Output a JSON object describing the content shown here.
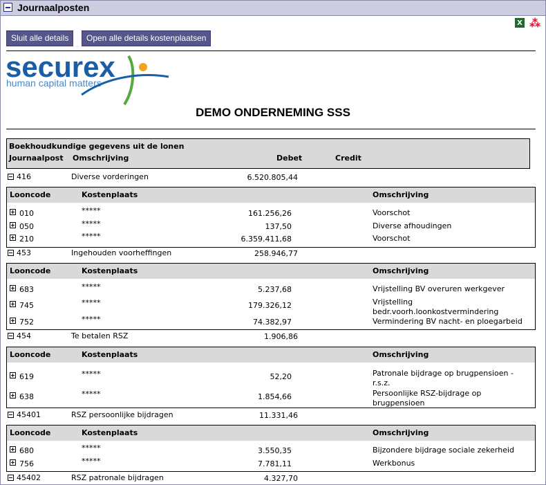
{
  "window": {
    "title": "Journaalposten"
  },
  "toolbar": {
    "close_details": "Sluit alle details",
    "open_details": "Open alle details kostenplaatsen"
  },
  "logo": {
    "brand": "securex",
    "tagline": "human capital matters"
  },
  "company_title": "DEMO ONDERNEMING SSS",
  "header": {
    "section_title": "Boekhoudkundige gegevens uit de lonen",
    "col_journal": "Journaalpost",
    "col_desc": "Omschrijving",
    "col_debet": "Debet",
    "col_credit": "Credit"
  },
  "sub_columns": {
    "looncode": "Looncode",
    "kostenplaats": "Kostenplaats",
    "omschrijving": "Omschrijving"
  },
  "journals": [
    {
      "code": "416",
      "desc": "Diverse vorderingen",
      "debet": "6.520.805,44",
      "lines": [
        {
          "code": "010",
          "kp": "*****",
          "amount": "161.256,26",
          "desc": "Voorschot"
        },
        {
          "code": "050",
          "kp": "*****",
          "amount": "137,50",
          "desc": "Diverse afhoudingen"
        },
        {
          "code": "210",
          "kp": "*****",
          "amount": "6.359.411,68",
          "desc": "Voorschot"
        }
      ]
    },
    {
      "code": "453",
      "desc": "Ingehouden voorheffingen",
      "debet": "258.946,77",
      "lines": [
        {
          "code": "683",
          "kp": "*****",
          "amount": "5.237,68",
          "desc": "Vrijstelling BV overuren werkgever"
        },
        {
          "code": "745",
          "kp": "*****",
          "amount": "179.326,12",
          "desc": "Vrijstelling",
          "desc2": "bedr.voorh.loonkostvermindering"
        },
        {
          "code": "752",
          "kp": "*****",
          "amount": "74.382,97",
          "desc": "Vermindering BV nacht- en ploegarbeid"
        }
      ]
    },
    {
      "code": "454",
      "desc": "Te betalen RSZ",
      "debet": "1.906,86",
      "lines": [
        {
          "code": "619",
          "kp": "*****",
          "amount": "52,20",
          "desc": "Patronale bijdrage op brugpensioen -",
          "desc2": "r.s.z."
        },
        {
          "code": "638",
          "kp": "*****",
          "amount": "1.854,66",
          "desc": "Persoonlijke RSZ-bijdrage op",
          "desc2": "brugpensioen"
        }
      ]
    },
    {
      "code": "45401",
      "desc": "RSZ persoonlijke bijdragen",
      "debet": "11.331,46",
      "lines": [
        {
          "code": "680",
          "kp": "*****",
          "amount": "3.550,35",
          "desc": "Bijzondere bijdrage sociale zekerheid"
        },
        {
          "code": "756",
          "kp": "*****",
          "amount": "7.781,11",
          "desc": "Werkbonus"
        }
      ]
    },
    {
      "code": "45402",
      "desc": "RSZ patronale bijdragen",
      "debet": "4.327,70"
    }
  ]
}
